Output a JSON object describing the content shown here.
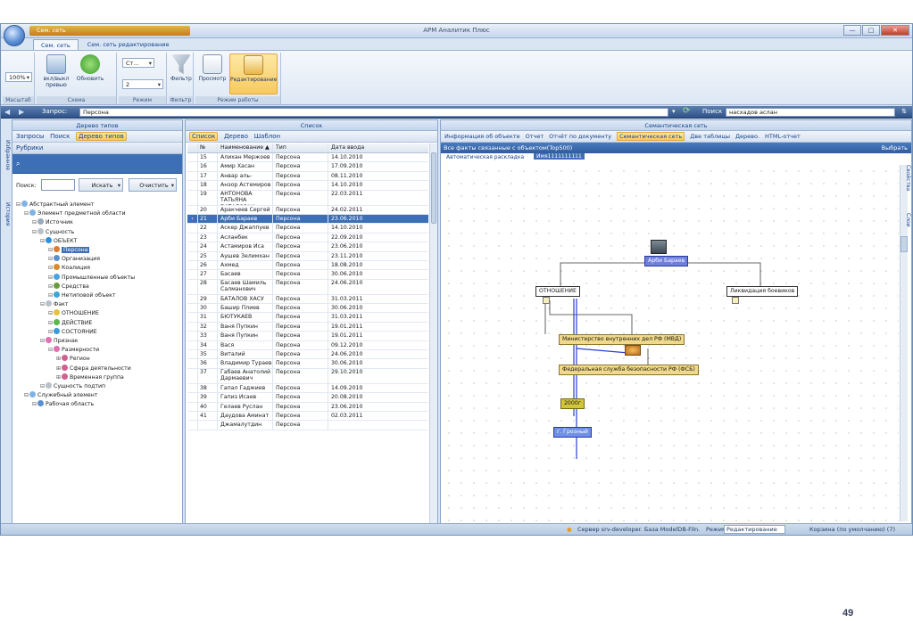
{
  "app": {
    "title": "АРМ Аналитик Плюс",
    "quick_access": "Сем. сеть",
    "window_controls": [
      "—",
      "□",
      "✕"
    ]
  },
  "ribbon_tabs": [
    "Сем. сеть",
    "Сем. сеть редактирование"
  ],
  "ribbon": {
    "zoom_value": "100%",
    "zoom_label": "Масштаб",
    "toggle_preview": "вкл/выкл превью",
    "refresh": "Обновить",
    "scheme_label": "Схема",
    "mode_combo_1": "Ст...",
    "mode_combo_2": "2",
    "mode_label": "Режим",
    "filter": "Фильтр",
    "filter_label": "Фильтр",
    "view": "Просмотр",
    "edit": "Редактирование",
    "work_mode_label": "Режим работы"
  },
  "query_bar": {
    "label": "Запрос:",
    "value": "Персона",
    "search_label": "Поиск",
    "search_value": "насхадов аслан"
  },
  "left_panel": {
    "title": "Дерево типов",
    "toolbar": [
      "Запросы",
      "Поиск",
      "Дерево типов"
    ],
    "rubrics": "Рубрики",
    "search_label": "Поиск:",
    "search_button": "Искать",
    "clear_button": "Очистить",
    "side_tabs": [
      "Избранное",
      "История"
    ],
    "tree": [
      {
        "label": "Абстрактный элемент",
        "level": 0,
        "color": "#7fb2e5"
      },
      {
        "label": "Элемент предметной области",
        "level": 1,
        "color": "#7fb2e5"
      },
      {
        "label": "Источник",
        "level": 2,
        "color": "#9aa9bb"
      },
      {
        "label": "Сущность",
        "level": 2,
        "color": "#b8c0c8"
      },
      {
        "label": "ОБЪЕКТ",
        "level": 3,
        "color": "#2f8fd8"
      },
      {
        "label": "Персона",
        "level": 4,
        "color": "#e07b2e",
        "selected": true
      },
      {
        "label": "Организация",
        "level": 4,
        "color": "#5a8fd0"
      },
      {
        "label": "Коалиция",
        "level": 4,
        "color": "#d88a30"
      },
      {
        "label": "Промышленные объекты",
        "level": 4,
        "color": "#4aa3df"
      },
      {
        "label": "Средства",
        "level": 4,
        "color": "#6b9c3a"
      },
      {
        "label": "Нетиповой объект",
        "level": 4,
        "color": "#39a6d8"
      },
      {
        "label": "Факт",
        "level": 3,
        "color": "#b8c0c8"
      },
      {
        "label": "ОТНОШЕНИЕ",
        "level": 4,
        "color": "#e6c23a"
      },
      {
        "label": "ДЕЙСТВИЕ",
        "level": 4,
        "color": "#58b84a"
      },
      {
        "label": "СОСТОЯНИЕ",
        "level": 4,
        "color": "#3a9ad8"
      },
      {
        "label": "Признак",
        "level": 3,
        "color": "#e070b0"
      },
      {
        "label": "Размерности",
        "level": 4,
        "color": "#e070b0"
      },
      {
        "label": "Регион",
        "level": 5,
        "color": "#d06090"
      },
      {
        "label": "Сфера деятельности",
        "level": 5,
        "color": "#d06090"
      },
      {
        "label": "Временная группа",
        "level": 5,
        "color": "#d06090"
      },
      {
        "label": "Сущность подтип",
        "level": 3,
        "color": "#b8c0c8"
      },
      {
        "label": "Служебный элемент",
        "level": 1,
        "color": "#7fb2e5"
      },
      {
        "label": "Рабочая область",
        "level": 2,
        "color": "#5a8fd0"
      }
    ]
  },
  "list_panel": {
    "title": "Список",
    "toolbar": [
      "Список",
      "Дерево",
      "Шаблон"
    ],
    "columns": [
      "№",
      "Наименование ▲",
      "Тип",
      "Дата ввода"
    ],
    "rows": [
      [
        "15",
        "Алихан Мержоев",
        "Персона",
        "14.10.2010"
      ],
      [
        "16",
        "Амир Хасан",
        "Персона",
        "17.09.2010"
      ],
      [
        "17",
        "Анвар аль-Авлаки",
        "Персона",
        "08.11.2010"
      ],
      [
        "18",
        "Анзор Астемиров",
        "Персона",
        "14.10.2010"
      ],
      [
        "19",
        "АНТОНОВА ТАТЬЯНА БАТАЛОВНА",
        "Персона",
        "22.03.2011"
      ],
      [
        "20",
        "Аракчеев Сергей",
        "Персона",
        "24.02.2011"
      ],
      [
        "21",
        "Арби Бараев",
        "Персона",
        "23.06.2010"
      ],
      [
        "22",
        "Аскер Джаппуев",
        "Персона",
        "14.10.2010"
      ],
      [
        "23",
        "Асланбек Вадалов",
        "Персона",
        "22.09.2010"
      ],
      [
        "24",
        "Астамиров Иса",
        "Персона",
        "23.06.2010"
      ],
      [
        "25",
        "Аушев Зелимхан",
        "Персона",
        "23.11.2010"
      ],
      [
        "26",
        "Ахмед Магомедов",
        "Персона",
        "18.08.2010"
      ],
      [
        "27",
        "Басаев (террорист)",
        "Персона",
        "30.06.2010"
      ],
      [
        "28",
        "Басаев Шамиль Салманович",
        "Персона",
        "24.06.2010"
      ],
      [
        "29",
        "БАТАЛОВ ХАСУ",
        "Персона",
        "31.03.2011"
      ],
      [
        "30",
        "Башир Плиев",
        "Персона",
        "30.06.2010"
      ],
      [
        "31",
        "БЮТУКАЕВ АСЛАН",
        "Персона",
        "31.03.2011"
      ],
      [
        "32",
        "Ваня Пупкин Тест",
        "Персона",
        "19.01.2011"
      ],
      [
        "33",
        "Ваня Пупкин Тест Два",
        "Персона",
        "19.01.2011"
      ],
      [
        "34",
        "Вася",
        "Персона",
        "09.12.2010"
      ],
      [
        "35",
        "Виталий Ведерников",
        "Персона",
        "24.06.2010"
      ],
      [
        "36",
        "Владимир Тураев",
        "Персона",
        "30.06.2010"
      ],
      [
        "37",
        "Габаев Анатолий Дармаевич",
        "Персона",
        "29.10.2010"
      ],
      [
        "38",
        "Гапал Гаджиев",
        "Персона",
        "14.09.2010"
      ],
      [
        "39",
        "Гапиз Исаев",
        "Персона",
        "20.08.2010"
      ],
      [
        "40",
        "Гелаев Руслан",
        "Персона",
        "23.06.2010"
      ],
      [
        "41",
        "Даудова Аминат",
        "Персона",
        "02.03.2011"
      ],
      [
        "",
        "Джамалутдин",
        "Персона",
        ""
      ]
    ],
    "selected_row": 6
  },
  "semantic_panel": {
    "title": "Семантическая сеть",
    "toolbar": [
      "Информация об объекте",
      "Отчет",
      "Отчёт по документу",
      "Семантическая сеть",
      "Две таблицы",
      "Дерево.",
      "HTML-отчет"
    ],
    "facts_header": "Все факты связанные с объектом(Top500)",
    "choose": "Выбрать",
    "tabs": [
      "Автоматическая раскладка",
      "Имя1111111111"
    ],
    "side_tabs": [
      "Свойства",
      "Слои"
    ],
    "nodes": {
      "person": "Арби Бараев",
      "relation": "ОТНОШЕНИЕ",
      "liquidation": "Ликвидация боевиков",
      "mvd": "Министерство внутренних дел РФ (МВД)",
      "fsb": "Федеральная служба безопасности РФ (ФСБ)",
      "year": "2000г",
      "city": "г. Грозный"
    }
  },
  "status_bar": {
    "server": "Сервер srv-developer. База ModelDB-Filn.",
    "mode_label": "Режим",
    "mode_value": "Редактирование",
    "basket": "Корзина (по умолчанию) (7)"
  },
  "page_number": "49",
  "colors": {
    "selection": "#3d6fb6",
    "ribbon_highlight": "#f8c95e",
    "node_person": "#6f7fe0",
    "node_org": "#f0d98a",
    "node_year": "#d2c53a",
    "node_city": "#6f8fe8"
  }
}
